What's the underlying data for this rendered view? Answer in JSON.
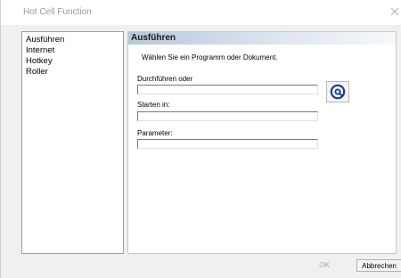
{
  "window": {
    "title": "Hot Cell Function",
    "close_glyph": "close-icon"
  },
  "sidebar": {
    "items": [
      {
        "label": "Ausführen"
      },
      {
        "label": "Internet"
      },
      {
        "label": "Hotkey"
      },
      {
        "label": "Roller"
      }
    ]
  },
  "panel": {
    "header": "Ausführen",
    "description": "Wählen Sie ein Programm oder Dokument.",
    "fields": [
      {
        "label": "Durchführen oder",
        "value": ""
      },
      {
        "label": "Starten in:",
        "value": ""
      },
      {
        "label": "Parameter:",
        "value": ""
      }
    ],
    "browse_icon": "at-sign-icon",
    "browse_color": "#1a3f8a"
  },
  "buttons": {
    "ok": "OK",
    "cancel": "Abbrechen"
  }
}
